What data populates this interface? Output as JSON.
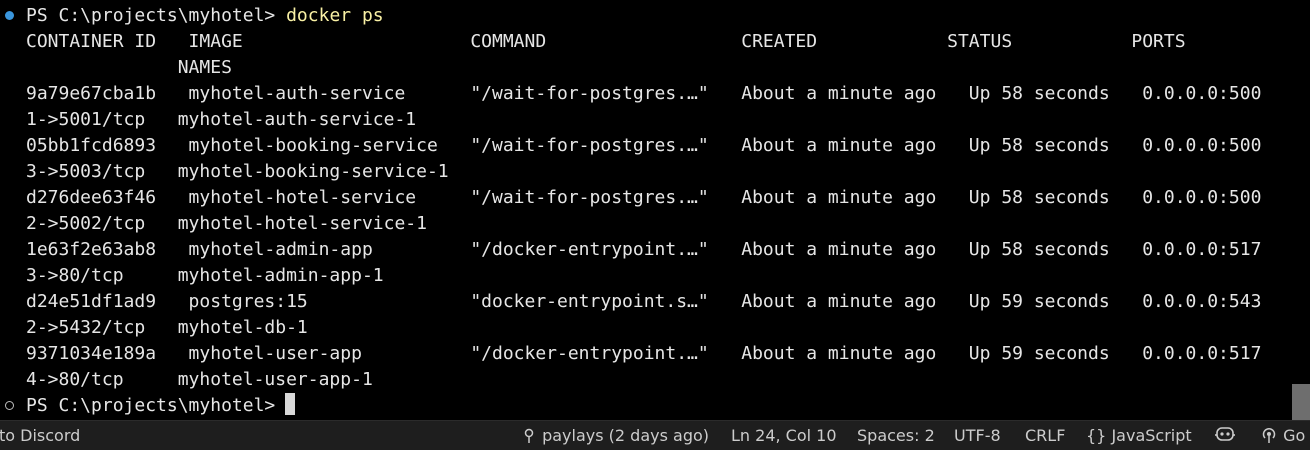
{
  "terminal": {
    "prompt": "PS C:\\projects\\myhotel>",
    "command": "docker ps",
    "lines": [
      "CONTAINER ID   IMAGE                     COMMAND                  CREATED            STATUS           PORTS",
      "              NAMES",
      "9a79e67cba1b   myhotel-auth-service      \"/wait-for-postgres.…\"   About a minute ago   Up 58 seconds   0.0.0.0:500",
      "1->5001/tcp   myhotel-auth-service-1",
      "05bb1fcd6893   myhotel-booking-service   \"/wait-for-postgres.…\"   About a minute ago   Up 58 seconds   0.0.0.0:500",
      "3->5003/tcp   myhotel-booking-service-1",
      "d276dee63f46   myhotel-hotel-service     \"/wait-for-postgres.…\"   About a minute ago   Up 58 seconds   0.0.0.0:500",
      "2->5002/tcp   myhotel-hotel-service-1",
      "1e63f2e63ab8   myhotel-admin-app         \"/docker-entrypoint.…\"   About a minute ago   Up 58 seconds   0.0.0.0:517",
      "3->80/tcp     myhotel-admin-app-1",
      "d24e51df1ad9   postgres:15               \"docker-entrypoint.s…\"   About a minute ago   Up 59 seconds   0.0.0.0:543",
      "2->5432/tcp   myhotel-db-1",
      "9371034e189a   myhotel-user-app          \"/docker-entrypoint.…\"   About a minute ago   Up 59 seconds   0.0.0.0:517",
      "4->80/tcp     myhotel-user-app-1"
    ],
    "final_prompt": "PS C:\\projects\\myhotel>"
  },
  "statusbar": {
    "discord": "to Discord",
    "git_blame": "paylays (2 days ago)",
    "cursor_position": "Ln 24, Col 10",
    "spaces": "Spaces: 2",
    "encoding": "UTF-8",
    "line_ending": "CRLF",
    "language_braces": "{}",
    "language": "JavaScript",
    "go_live": "Go"
  },
  "colors": {
    "terminal_background": "#000000",
    "terminal_text": "#e6e6e6",
    "command_text": "#f9f1a5",
    "success_dot": "#3a96dd",
    "statusbar_background": "#1e1e1e",
    "statusbar_text": "#cccccc"
  },
  "icons": [
    "git-commit-icon",
    "copilot-icon",
    "broadcast-icon"
  ]
}
